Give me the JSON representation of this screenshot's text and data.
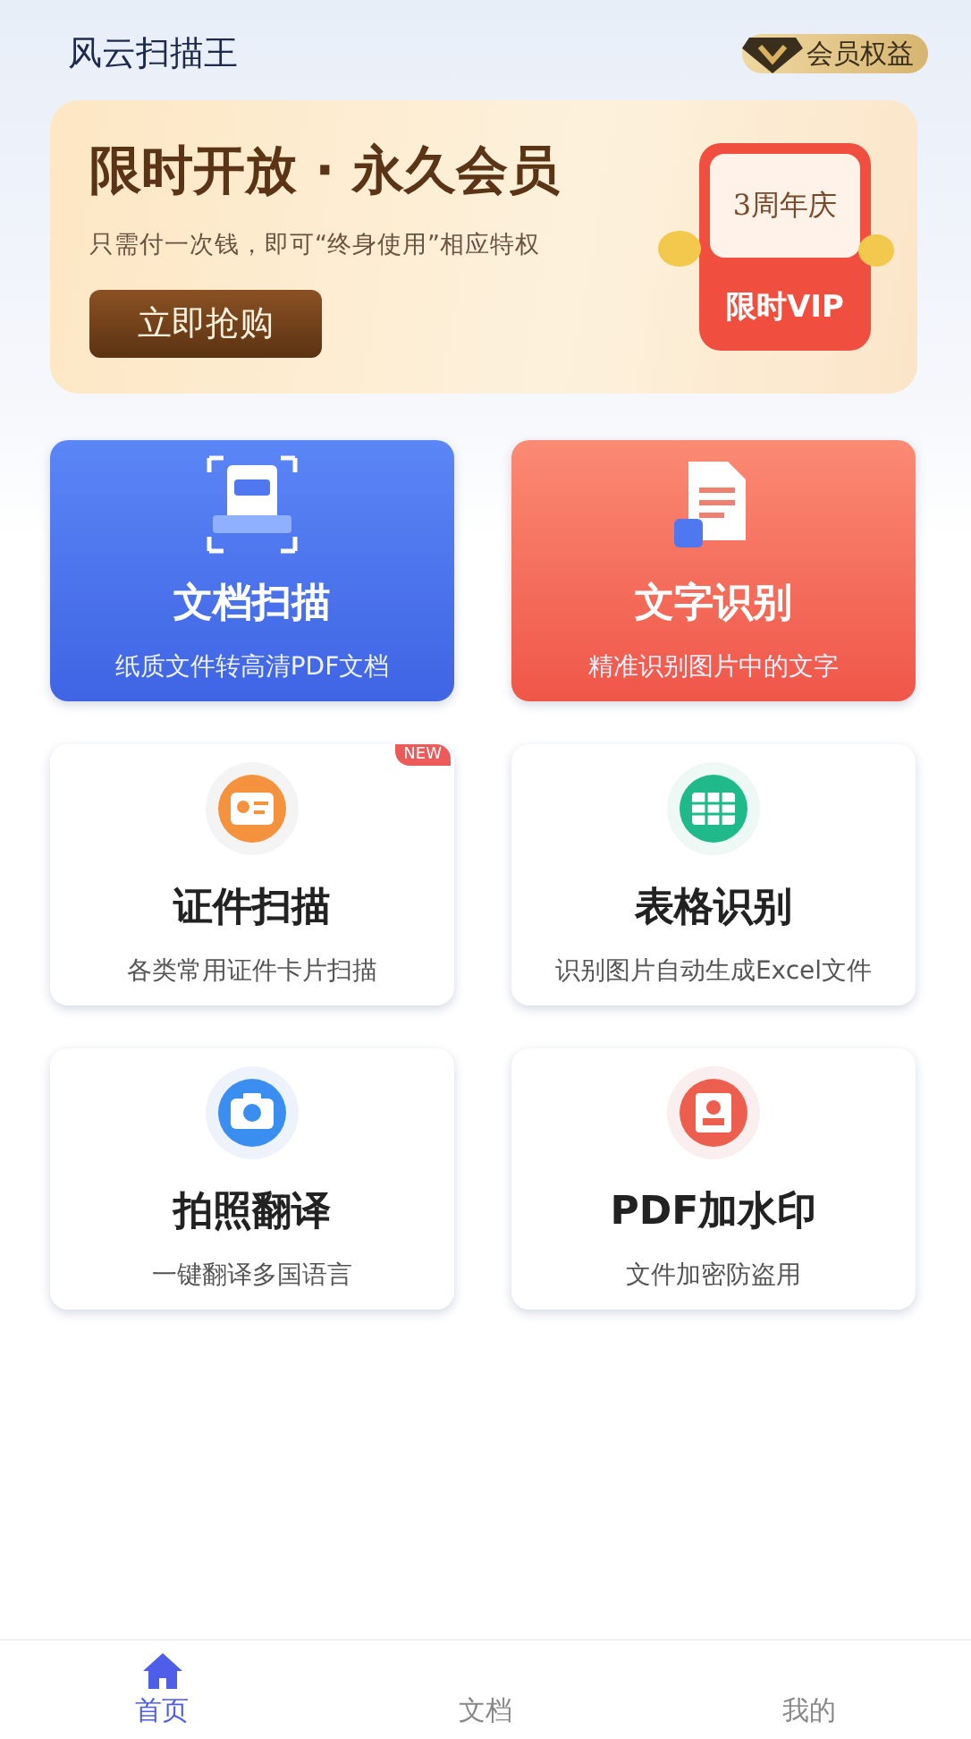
{
  "header": {
    "title": "风云扫描王",
    "member_button": "会员权益"
  },
  "promo": {
    "headline": "限时开放 · 永久会员",
    "subtitle": "只需付一次钱，即可“终身使用”相应特权",
    "button": "立即抢购",
    "badge_top": "3周年庆",
    "badge_bottom": "限时VIP"
  },
  "tools": [
    {
      "kind": "pdf",
      "title": "文档扫描",
      "subtitle": "纸质文件转高清PDF文档"
    },
    {
      "kind": "doc",
      "title": "文字识别",
      "subtitle": "精准识别图片中的文字"
    },
    {
      "kind": "id",
      "title": "证件扫描",
      "subtitle": "各类常用证件卡片扫描",
      "badge": "NEW"
    },
    {
      "kind": "table",
      "title": "表格识别",
      "subtitle": "识别图片自动生成Excel文件"
    },
    {
      "kind": "camera",
      "title": "拍照翻译",
      "subtitle": "一键翻译多国语言"
    },
    {
      "kind": "stamp",
      "title": "PDF加水印",
      "subtitle": "文件加密防盗用"
    }
  ],
  "tab_bar": [
    {
      "label": "首页",
      "selected": true
    },
    {
      "label": "文档",
      "selected": false
    },
    {
      "label": "我的",
      "selected": false
    }
  ]
}
